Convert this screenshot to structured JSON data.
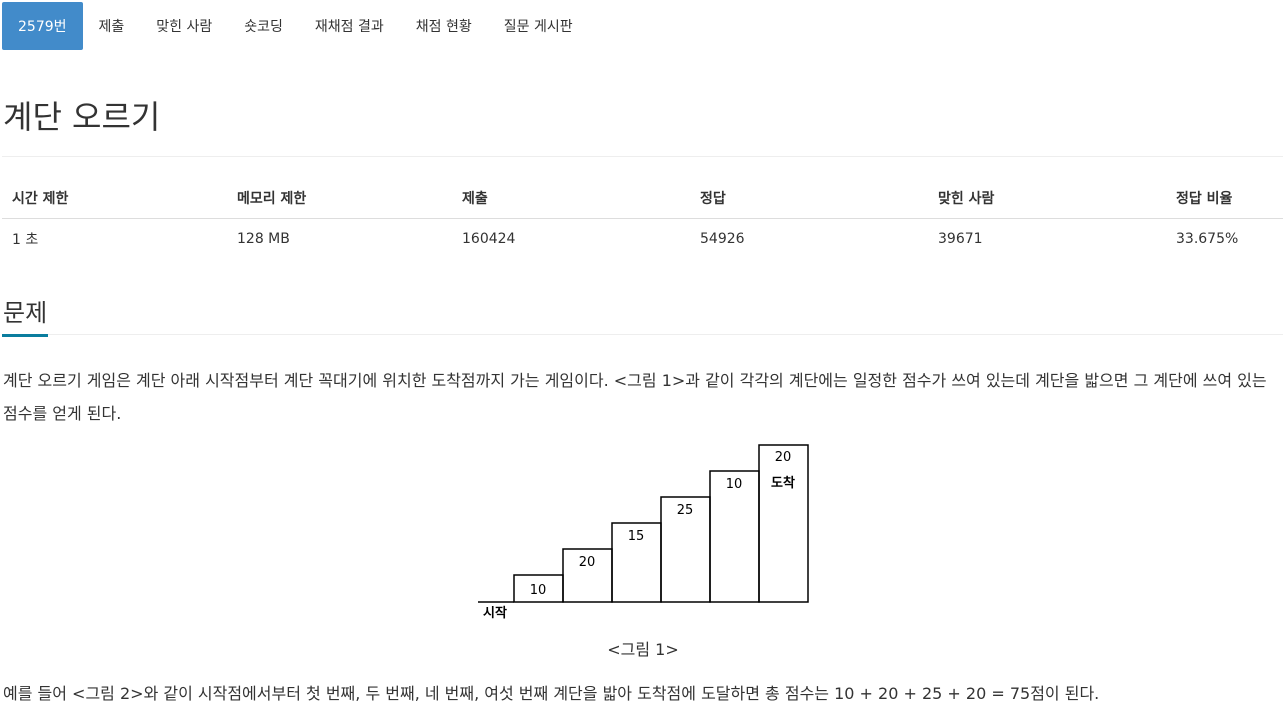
{
  "tabs": [
    {
      "label": "2579번",
      "active": true
    },
    {
      "label": "제출",
      "active": false
    },
    {
      "label": "맞힌 사람",
      "active": false
    },
    {
      "label": "숏코딩",
      "active": false
    },
    {
      "label": "재채점 결과",
      "active": false
    },
    {
      "label": "채점 현황",
      "active": false
    },
    {
      "label": "질문 게시판",
      "active": false
    }
  ],
  "problem": {
    "title": "계단 오르기"
  },
  "info_table": {
    "headers": [
      "시간 제한",
      "메모리 제한",
      "제출",
      "정답",
      "맞힌 사람",
      "정답 비율"
    ],
    "values": [
      "1 초",
      "128 MB",
      "160424",
      "54926",
      "39671",
      "33.675%"
    ]
  },
  "section": {
    "title": "문제",
    "paragraph1": "계단 오르기 게임은 계단 아래 시작점부터 계단 꼭대기에 위치한 도착점까지 가는 게임이다. <그림 1>과 같이 각각의 계단에는 일정한 점수가 쓰여 있는데 계단을 밟으면 그 계단에 쓰여 있는 점수를 얻게 된다.",
    "paragraph2": "예를 들어 <그림 2>와 같이 시작점에서부터 첫 번째, 두 번째, 네 번째, 여섯 번째 계단을 밟아 도착점에 도달하면 총 점수는 10 + 20 + 25 + 20 = 75점이 된다."
  },
  "figure": {
    "caption": "<그림 1>",
    "start_label": "시작",
    "end_label": "도착",
    "step_scores": [
      "10",
      "20",
      "15",
      "25",
      "10",
      "20"
    ]
  },
  "colors": {
    "accent": "#428bca",
    "section_underline": "#0a7d9e",
    "text": "#333333"
  }
}
